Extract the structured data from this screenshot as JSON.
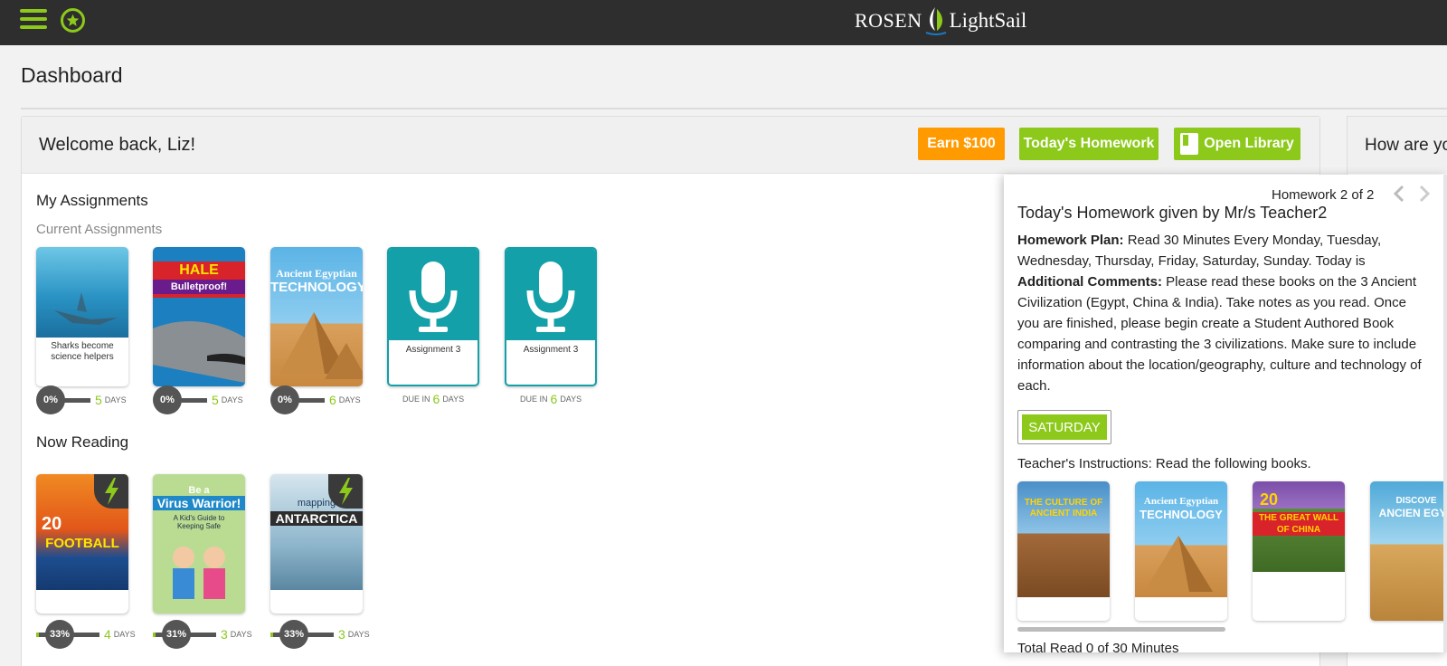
{
  "brand": {
    "rosen": "ROSEN",
    "lightsail": "LightSail"
  },
  "page": {
    "title": "Dashboard"
  },
  "welcome": {
    "greeting": "Welcome back, Liz!",
    "earn_label": "Earn $100",
    "homework_label": "Today's Homework",
    "library_label": "Open Library"
  },
  "assignments": {
    "section_title": "My Assignments",
    "subsection": "Current Assignments",
    "items": [
      {
        "type": "book",
        "caption_line1": "Sharks become",
        "caption_line2": "science helpers",
        "percent": "0%",
        "days": "5",
        "days_label": "DAYS"
      },
      {
        "type": "book",
        "cover_line1": "HALE SHARK",
        "cover_line2": "Bulletproof!",
        "percent": "0%",
        "days": "5",
        "days_label": "DAYS"
      },
      {
        "type": "book",
        "cover_line1": "Ancient Egyptian",
        "cover_line2": "TECHNOLOGY",
        "percent": "0%",
        "days": "6",
        "days_label": "DAYS"
      },
      {
        "type": "recording",
        "label": "Assignment 3",
        "due_prefix": "DUE IN",
        "days": "6",
        "days_label": "DAYS"
      },
      {
        "type": "recording",
        "label": "Assignment 3",
        "due_prefix": "DUE IN",
        "days": "6",
        "days_label": "DAYS"
      }
    ]
  },
  "now_reading": {
    "section_title": "Now Reading",
    "items": [
      {
        "cover_line1": "20",
        "cover_line2": "FOOTBALL",
        "percent": "33%",
        "progress": 0.33,
        "days": "4",
        "days_label": "DAYS"
      },
      {
        "cover_line1": "Be a",
        "cover_line2": "Virus Warrior!",
        "cover_line3": "A Kid's Guide to Keeping Safe",
        "percent": "31%",
        "progress": 0.31,
        "days": "3",
        "days_label": "DAYS"
      },
      {
        "cover_line1": "mapping",
        "cover_line2": "ANTARCTICA",
        "percent": "33%",
        "progress": 0.33,
        "days": "3",
        "days_label": "DAYS"
      }
    ]
  },
  "side": {
    "title": "How are yo"
  },
  "homework_panel": {
    "counter": "Homework 2 of 2",
    "title": "Today's Homework given by Mr/s Teacher2",
    "plan_label": "Homework Plan:",
    "plan_text": " Read 30 Minutes Every Monday, Tuesday, Wednesday, Thursday, Friday, Saturday, Sunday. Today is",
    "comments_label": "Additional Comments:",
    "comments_text": " Please read these books on the 3 Ancient Civilization (Egypt, China & India). Take notes as you read. Once you are finished, please begin create a Student Authored Book comparing and contrasting the 3 civilizations. Make sure to include information about the location/geography, culture and technology of each.",
    "day": "SATURDAY",
    "instructions_label": "Teacher's Instructions:",
    "instructions_text": " Read the following books.",
    "books": [
      {
        "line1": "THE CULTURE OF",
        "line2": "ANCIENT INDIA"
      },
      {
        "line1": "Ancient Egyptian",
        "line2": "TECHNOLOGY"
      },
      {
        "line1": "20",
        "line2": "THE GREAT WALL OF CHINA"
      },
      {
        "line1": "DISCOVE",
        "line2": "ANCIEN EGYP"
      }
    ],
    "total": "Total Read 0 of 30 Minutes"
  },
  "colors": {
    "accent_green": "#8cc91a",
    "orange": "#ff9a00",
    "teal": "#13a0a8",
    "topbar": "#2e2e2e"
  }
}
